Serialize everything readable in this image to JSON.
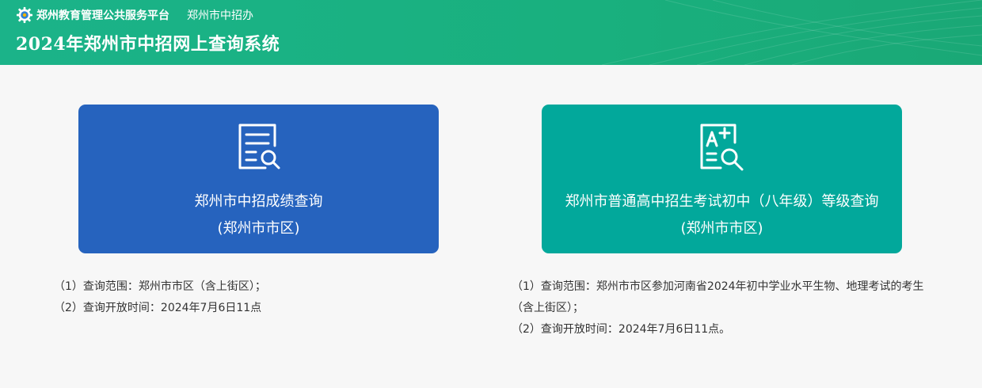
{
  "header": {
    "platform_name": "郑州教育管理公共服务平台",
    "office_name": "郑州市中招办",
    "system_title": "2024年郑州市中招网上查询系统",
    "icon": "gear-icon"
  },
  "cards": [
    {
      "title": "郑州市中招成绩查询",
      "subtitle": "(郑州市市区)",
      "icon": "document-search-icon",
      "color": "#2663be"
    },
    {
      "title": "郑州市普通高中招生考试初中（八年级）等级查询",
      "subtitle": "(郑州市市区)",
      "icon": "grade-search-icon",
      "color": "#02a89b"
    }
  ],
  "notes": {
    "left": [
      "（1）查询范围：郑州市市区（含上街区）；",
      "（2）查询开放时间：2024年7月6日11点"
    ],
    "right": [
      "（1）查询范围：郑州市市区参加河南省2024年初中学业水平生物、地理考试的考生（含上街区）；",
      "（2）查询开放时间：2024年7月6日11点。"
    ]
  },
  "colors": {
    "header": "#1bb389",
    "background": "#f7f7f7"
  }
}
